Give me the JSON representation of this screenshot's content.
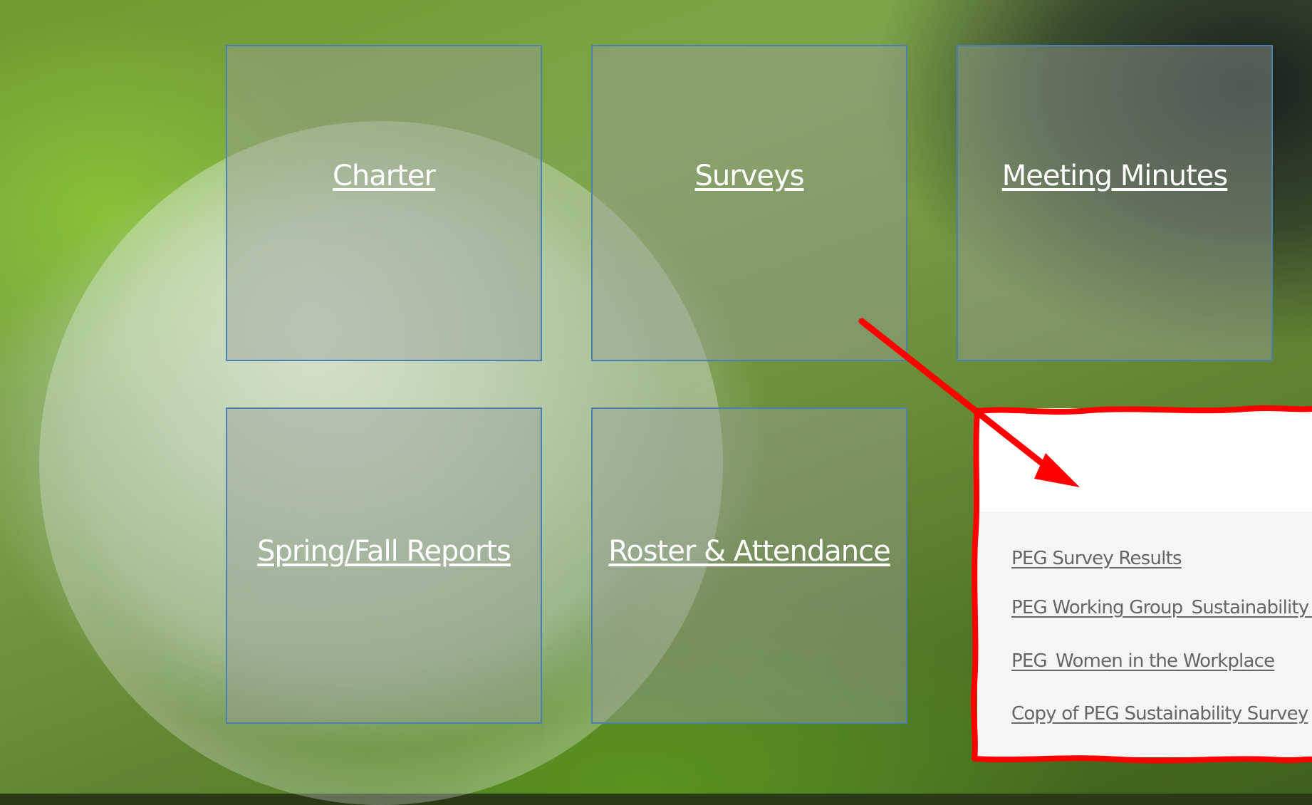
{
  "tiles": {
    "charter": "Charter",
    "surveys": "Surveys",
    "meeting_minutes": "Meeting Minutes",
    "reports": "Spring/Fall Reports",
    "roster": "Roster & Attendance"
  },
  "survey_panel": {
    "links": [
      "PEG Survey Results",
      "PEG Working Group_Sustainability S",
      "PEG_Women in the Workplace",
      "Copy of PEG Sustainability Survey"
    ]
  },
  "colors": {
    "tile_border": "#4a7fb0",
    "annotation": "#ff0000",
    "link_gray": "#666666"
  },
  "icons": {
    "annotation_arrow": "red-arrow-icon"
  }
}
